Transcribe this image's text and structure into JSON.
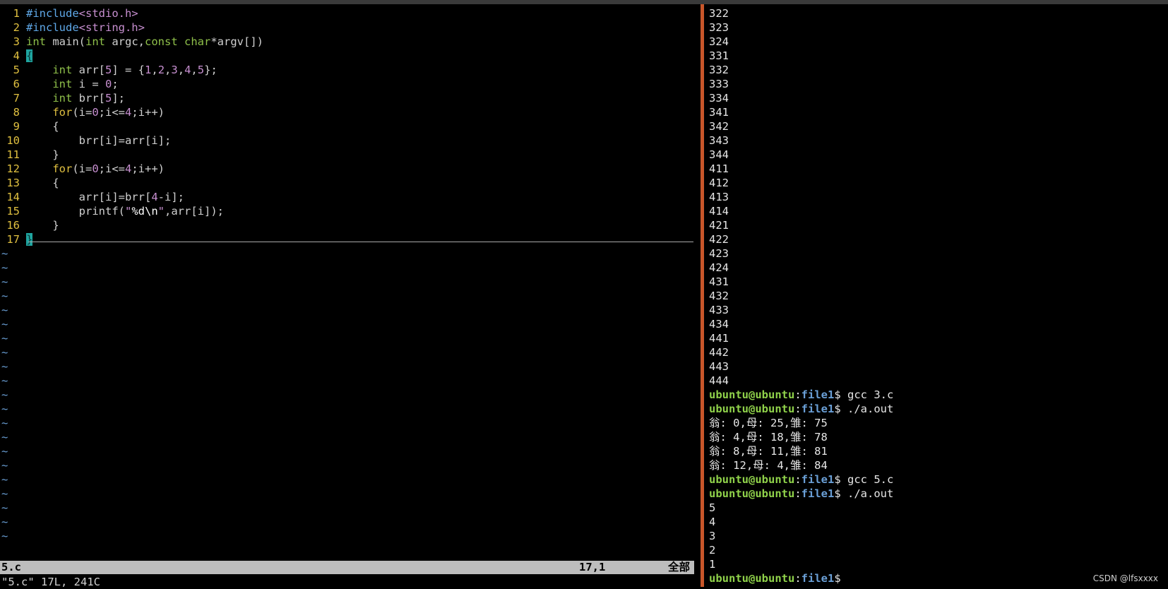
{
  "editor": {
    "tilde_char": "~",
    "lines": [
      {
        "num": "1",
        "tokens": [
          [
            "pp",
            "#include"
          ],
          [
            "inc",
            "<stdio.h>"
          ]
        ]
      },
      {
        "num": "2",
        "tokens": [
          [
            "pp",
            "#include"
          ],
          [
            "inc",
            "<string.h>"
          ]
        ]
      },
      {
        "num": "3",
        "tokens": [
          [
            "ty",
            "int"
          ],
          [
            "var",
            " main("
          ],
          [
            "ty",
            "int"
          ],
          [
            "var",
            " argc,"
          ],
          [
            "ty",
            "const"
          ],
          [
            "var",
            " "
          ],
          [
            "ty",
            "char"
          ],
          [
            "var",
            "*argv[])"
          ]
        ]
      },
      {
        "num": "4",
        "tokens": [
          [
            "hl-brace",
            "{"
          ]
        ]
      },
      {
        "num": "5",
        "tokens": [
          [
            "var",
            "    "
          ],
          [
            "ty",
            "int"
          ],
          [
            "var",
            " arr["
          ],
          [
            "num",
            "5"
          ],
          [
            "var",
            "] = {"
          ],
          [
            "num",
            "1"
          ],
          [
            "var",
            ","
          ],
          [
            "num",
            "2"
          ],
          [
            "var",
            ","
          ],
          [
            "num",
            "3"
          ],
          [
            "var",
            ","
          ],
          [
            "num",
            "4"
          ],
          [
            "var",
            ","
          ],
          [
            "num",
            "5"
          ],
          [
            "var",
            "};"
          ]
        ]
      },
      {
        "num": "6",
        "tokens": [
          [
            "var",
            "    "
          ],
          [
            "ty",
            "int"
          ],
          [
            "var",
            " i = "
          ],
          [
            "num",
            "0"
          ],
          [
            "var",
            ";"
          ]
        ]
      },
      {
        "num": "7",
        "tokens": [
          [
            "var",
            "    "
          ],
          [
            "ty",
            "int"
          ],
          [
            "var",
            " brr["
          ],
          [
            "num",
            "5"
          ],
          [
            "var",
            "];"
          ]
        ]
      },
      {
        "num": "8",
        "tokens": [
          [
            "var",
            "    "
          ],
          [
            "kw",
            "for"
          ],
          [
            "var",
            "(i="
          ],
          [
            "num",
            "0"
          ],
          [
            "var",
            ";i<="
          ],
          [
            "num",
            "4"
          ],
          [
            "var",
            ";i++)"
          ]
        ]
      },
      {
        "num": "9",
        "tokens": [
          [
            "var",
            "    {"
          ]
        ]
      },
      {
        "num": "10",
        "tokens": [
          [
            "var",
            "        brr[i]=arr[i];"
          ]
        ]
      },
      {
        "num": "11",
        "tokens": [
          [
            "var",
            "    }"
          ]
        ]
      },
      {
        "num": "12",
        "tokens": [
          [
            "var",
            "    "
          ],
          [
            "kw",
            "for"
          ],
          [
            "var",
            "(i="
          ],
          [
            "num",
            "0"
          ],
          [
            "var",
            ";i<="
          ],
          [
            "num",
            "4"
          ],
          [
            "var",
            ";i++)"
          ]
        ]
      },
      {
        "num": "13",
        "tokens": [
          [
            "var",
            "    {"
          ]
        ]
      },
      {
        "num": "14",
        "tokens": [
          [
            "var",
            "        arr[i]=brr["
          ],
          [
            "num",
            "4"
          ],
          [
            "var",
            "-i];"
          ]
        ]
      },
      {
        "num": "15",
        "tokens": [
          [
            "var",
            "        printf("
          ],
          [
            "str",
            "\""
          ],
          [
            "esc",
            "%d\\n"
          ],
          [
            "str",
            "\""
          ],
          [
            "var",
            ",arr[i]);"
          ]
        ]
      },
      {
        "num": "16",
        "tokens": [
          [
            "var",
            "    }"
          ]
        ]
      },
      {
        "num": "17",
        "tokens": [
          [
            "hl-brace",
            "}"
          ]
        ]
      }
    ],
    "status": {
      "filename": "5.c",
      "position": "17,1",
      "scroll": "全部"
    },
    "cmdline": "\"5.c\" 17L, 241C"
  },
  "terminal": {
    "lines": [
      {
        "text": "322"
      },
      {
        "text": "323"
      },
      {
        "text": "324"
      },
      {
        "text": "331"
      },
      {
        "text": "332"
      },
      {
        "text": "333"
      },
      {
        "text": "334"
      },
      {
        "text": "341"
      },
      {
        "text": "342"
      },
      {
        "text": "343"
      },
      {
        "text": "344"
      },
      {
        "text": "411"
      },
      {
        "text": "412"
      },
      {
        "text": "413"
      },
      {
        "text": "414"
      },
      {
        "text": "421"
      },
      {
        "text": "422"
      },
      {
        "text": "423"
      },
      {
        "text": "424"
      },
      {
        "text": "431"
      },
      {
        "text": "432"
      },
      {
        "text": "433"
      },
      {
        "text": "434"
      },
      {
        "text": "441"
      },
      {
        "text": "442"
      },
      {
        "text": "443"
      },
      {
        "text": "444"
      },
      {
        "prompt": true,
        "cmd": " gcc 3.c"
      },
      {
        "prompt": true,
        "cmd": " ./a.out"
      },
      {
        "text": "翁: 0,母: 25,雏: 75"
      },
      {
        "text": "翁: 4,母: 18,雏: 78"
      },
      {
        "text": "翁: 8,母: 11,雏: 81"
      },
      {
        "text": "翁: 12,母: 4,雏: 84"
      },
      {
        "prompt": true,
        "cmd": " gcc 5.c"
      },
      {
        "prompt": true,
        "cmd": " ./a.out"
      },
      {
        "text": "5"
      },
      {
        "text": "4"
      },
      {
        "text": "3"
      },
      {
        "text": "2"
      },
      {
        "text": "1"
      },
      {
        "prompt": true,
        "cmd": " "
      }
    ],
    "prompt_user": "ubuntu@ubuntu",
    "prompt_sep": ":",
    "prompt_path": "file1",
    "prompt_end": "$"
  },
  "watermark": "CSDN @lfsxxxx"
}
